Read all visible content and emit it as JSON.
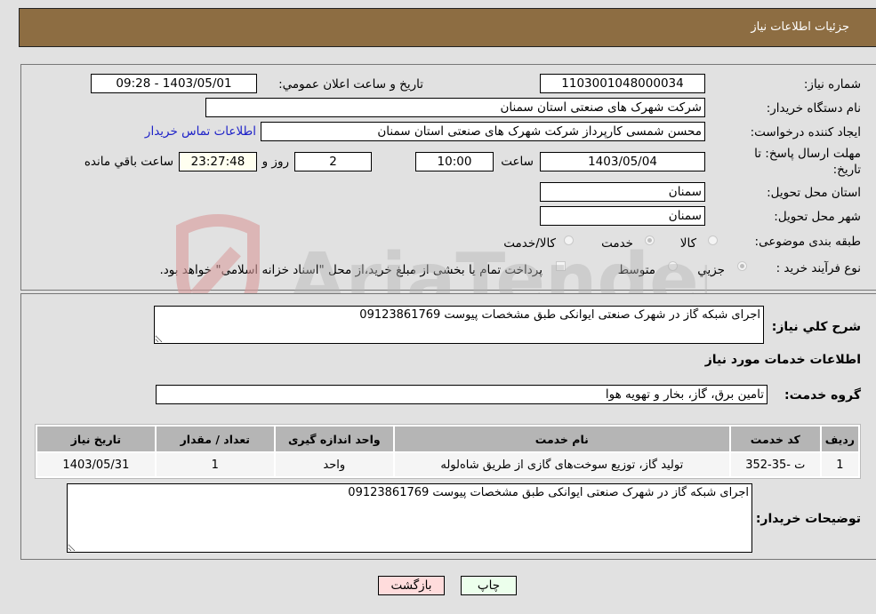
{
  "header": {
    "title": "جزئیات اطلاعات نیاز"
  },
  "form": {
    "need_number": {
      "label": "شماره نیاز:",
      "value": "1103001048000034"
    },
    "announce_datetime": {
      "label": "تاريخ و ساعت اعلان عمومي:",
      "value": "1403/05/01 - 09:28"
    },
    "buyer_org": {
      "label": "نام دستگاه خريدار:",
      "value": "شرکت شهرک های صنعتی استان سمنان"
    },
    "requester": {
      "label": "ايجاد کننده درخواست:",
      "value": "محسن شمسی کارپرداز شرکت شهرک های صنعتی استان سمنان"
    },
    "buyer_contact_link": "اطلاعات تماس خريدار",
    "deadline": {
      "label_line1": "مهلت ارسال پاسخ: تا",
      "label_line2": "تاریخ:",
      "date": "1403/05/04",
      "time_label": "ساعت",
      "time": "10:00",
      "days": "2",
      "days_label": "روز و",
      "remaining": "23:27:48",
      "remaining_label": "ساعت باقي مانده"
    },
    "province": {
      "label": "استان محل تحويل:",
      "value": "سمنان"
    },
    "city": {
      "label": "شهر محل تحويل:",
      "value": "سمنان"
    },
    "category": {
      "label": "طبقه بندی موضوعی:",
      "options": [
        "کالا",
        "خدمت",
        "کالا/خدمت"
      ],
      "selected": "خدمت"
    },
    "purchase_type": {
      "label": "نوع فرآيند خريد :",
      "options": [
        "جزيي",
        "متوسط"
      ],
      "selected": "جزيي",
      "treasury_note": "پرداخت تمام يا بخشی از مبلغ خريد،از محل \"اسناد خزانه اسلامی\" خواهد بود."
    }
  },
  "summary": {
    "label": "شرح کلي نياز:",
    "value": "اجرای شبکه گاز در شهرک صنعتی ایوانکی طبق مشخصات پیوست 09123861769"
  },
  "services": {
    "section_title": "اطلاعات خدمات مورد نياز",
    "group_label": "گروه خدمت:",
    "group_value": "تامين برق، گاز، بخار و تهويه هوا",
    "table": {
      "headers": [
        "رديف",
        "کد خدمت",
        "نام خدمت",
        "واحد اندازه گيری",
        "تعداد / مقدار",
        "تاريخ نياز"
      ],
      "rows": [
        [
          "1",
          "ت -35-352",
          "توليد گاز، توزيع سوخت‌های گازی از طريق شاه‌لوله",
          "واحد",
          "1",
          "1403/05/31"
        ]
      ]
    }
  },
  "buyer_notes": {
    "label": "توضيحات خريدار:",
    "value": "اجرای شبکه گاز در شهرک صنعتی ایوانکی طبق مشخصات پیوست 09123861769"
  },
  "buttons": {
    "print": "چاپ",
    "back": "بازگشت"
  },
  "watermark": {
    "text": "AriaTender.neT"
  }
}
